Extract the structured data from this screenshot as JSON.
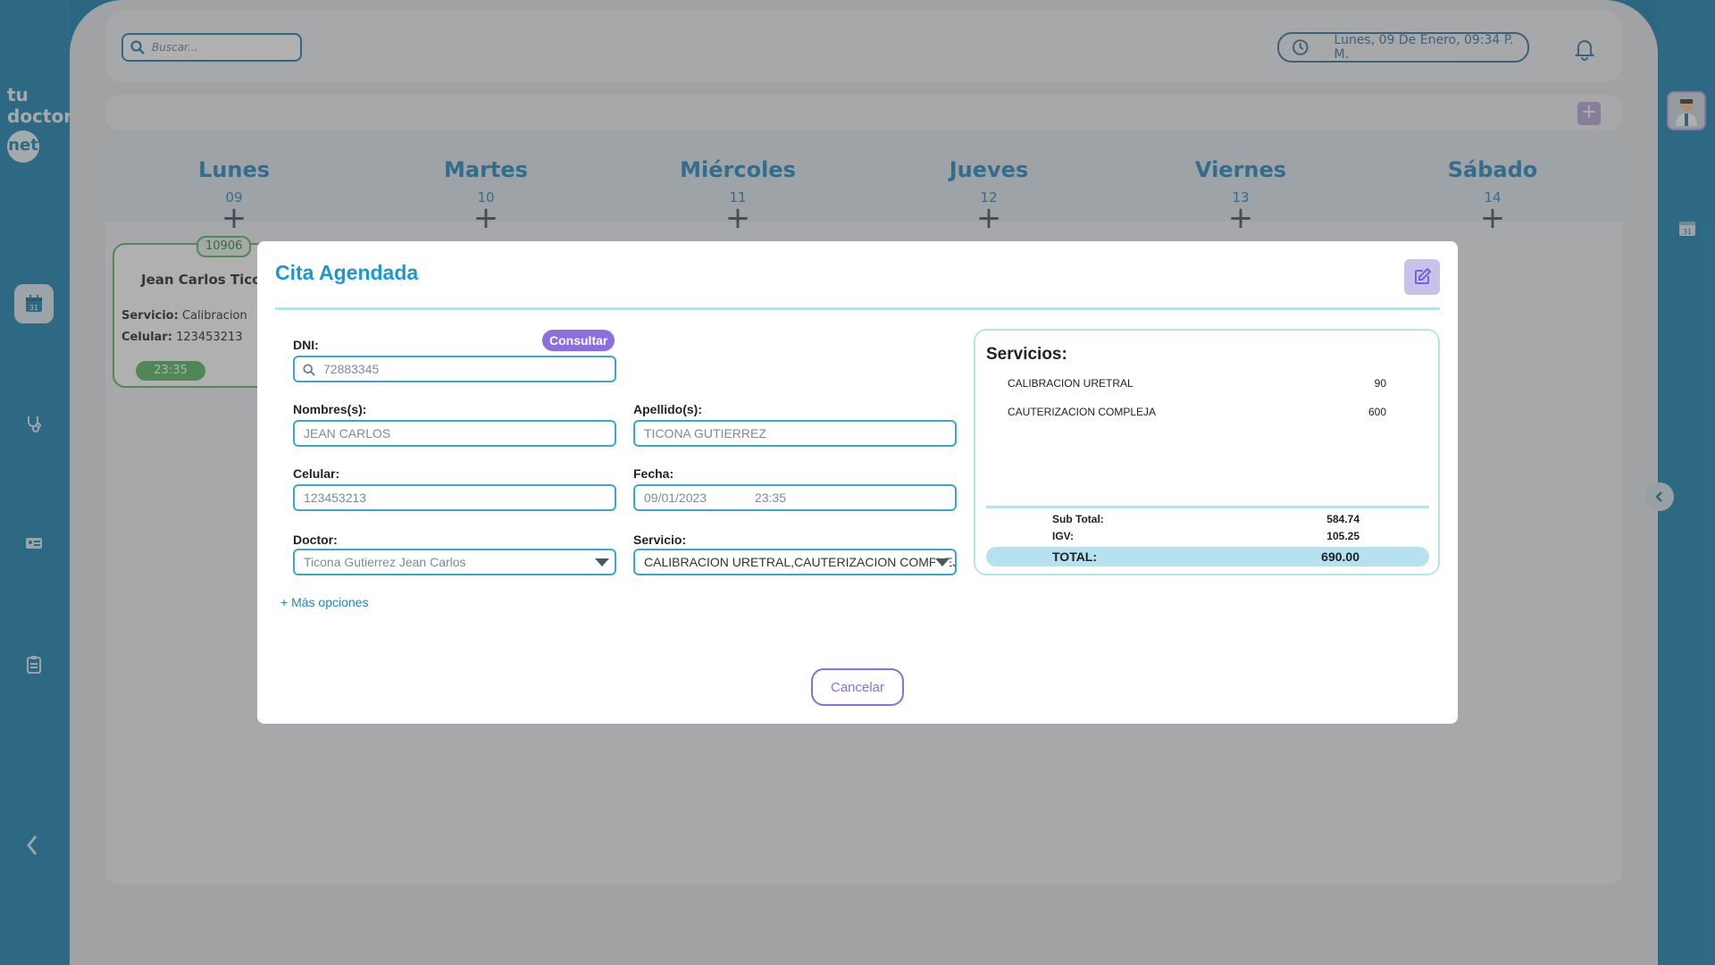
{
  "logo": {
    "line1": "tu",
    "line2": "doctor",
    "line3": "net"
  },
  "search": {
    "placeholder": "Buscar..."
  },
  "header": {
    "datetime": "Lunes, 09 De Enero, 09:34 P. M."
  },
  "calendar": {
    "days": [
      {
        "name": "Lunes",
        "date": "09"
      },
      {
        "name": "Martes",
        "date": "10"
      },
      {
        "name": "Miércoles",
        "date": "11"
      },
      {
        "name": "Jueves",
        "date": "12"
      },
      {
        "name": "Viernes",
        "date": "13"
      },
      {
        "name": "Sábado",
        "date": "14"
      }
    ],
    "appointment": {
      "code": "10906",
      "name": "Jean Carlos Ticona",
      "service_label": "Servicio:",
      "service_value": "Calibracion",
      "phone_label": "Celular:",
      "phone_value": "123453213",
      "time": "23:35"
    }
  },
  "modal": {
    "title": "Cita Agendada",
    "dni": {
      "label": "DNI:",
      "value": "72883345",
      "consult_label": "Consultar"
    },
    "nombres": {
      "label": "Nombres(s):",
      "value": "JEAN CARLOS"
    },
    "apellidos": {
      "label": "Apellido(s):",
      "value": "TICONA GUTIERREZ"
    },
    "celular": {
      "label": "Celular:",
      "value": "123453213"
    },
    "fecha": {
      "label": "Fecha:",
      "date": "09/01/2023",
      "time": "23:35"
    },
    "doctor": {
      "label": "Doctor:",
      "value": "Ticona Gutierrez Jean Carlos"
    },
    "servicio": {
      "label": "Servicio:",
      "value": "CALIBRACION URETRAL,CAUTERIZACION COMPLEJA"
    },
    "more_options": "+ Más opciones",
    "cancel_label": "Cancelar",
    "services": {
      "title": "Servicios:",
      "items": [
        {
          "name": "CALIBRACION URETRAL",
          "price": "90"
        },
        {
          "name": "CAUTERIZACION COMPLEJA",
          "price": "600"
        }
      ],
      "subtotal_label": "Sub Total:",
      "subtotal": "584.74",
      "igv_label": "IGV:",
      "igv": "105.25",
      "total_label": "TOTAL:",
      "total": "690.00"
    }
  }
}
